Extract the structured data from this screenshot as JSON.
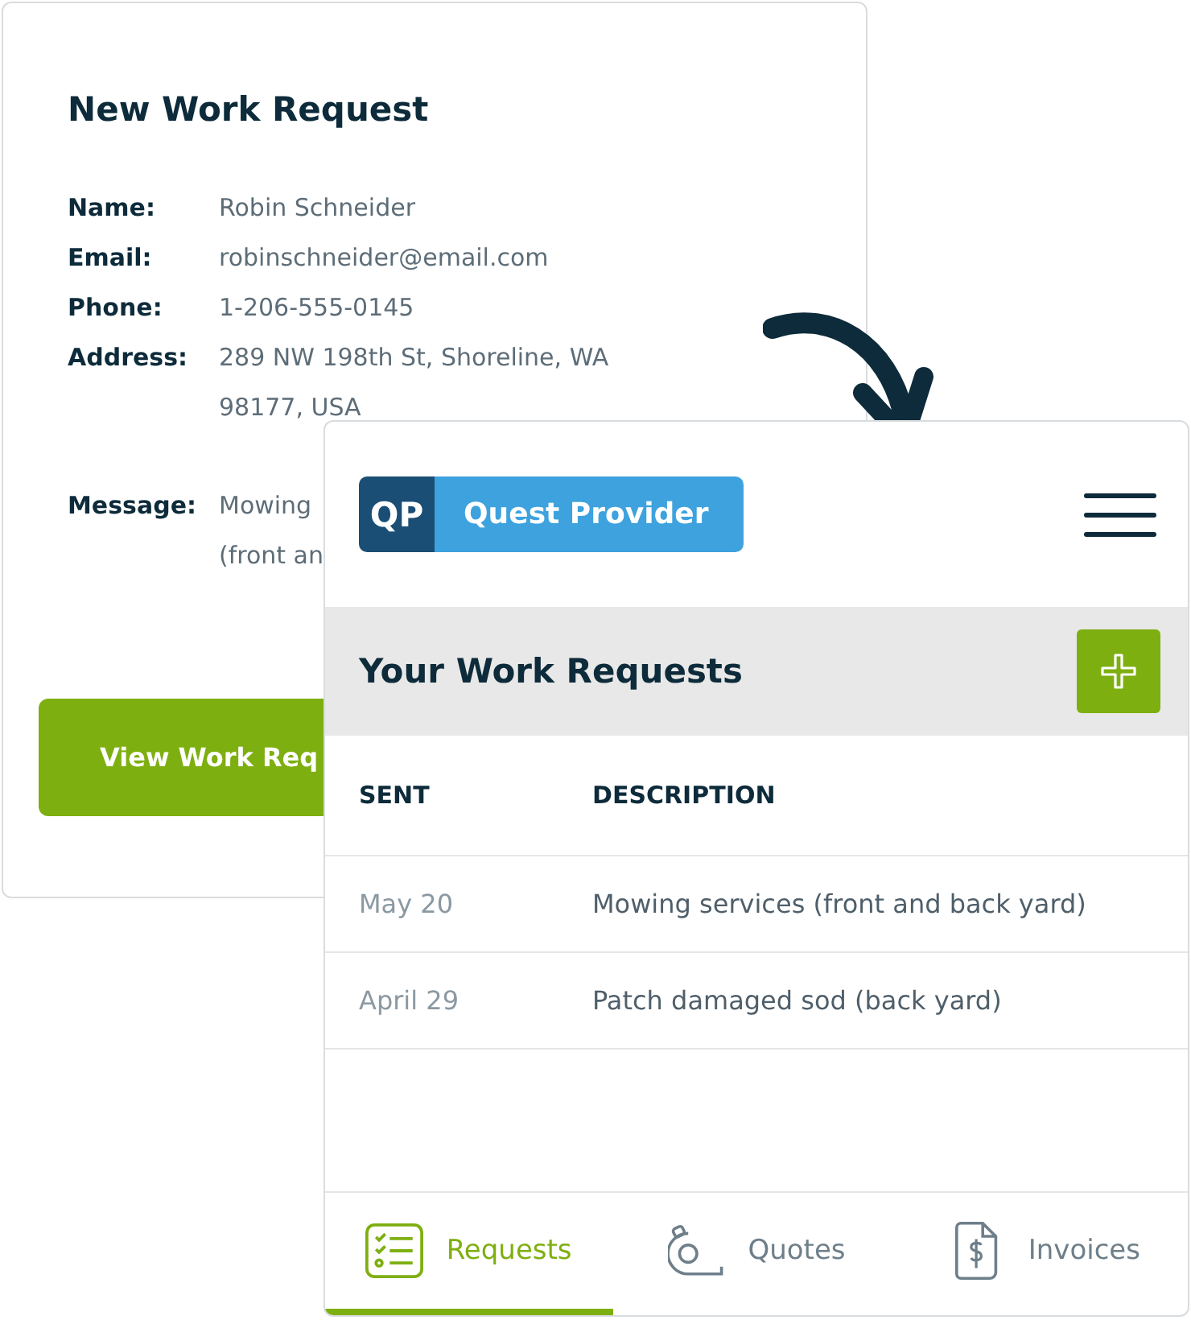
{
  "request_card": {
    "title": "New Work Request",
    "fields": [
      {
        "label": "Name:",
        "value": "Robin Schneider"
      },
      {
        "label": "Email:",
        "value": "robinschneider@email.com"
      },
      {
        "label": "Phone:",
        "value": "1-206-555-0145"
      },
      {
        "label": "Address:",
        "value": "289 NW 198th St, Shoreline, WA",
        "value_line_2": "98177, USA"
      },
      {
        "label": "Message:",
        "value": "Mowing",
        "value_line_2": "(front an"
      }
    ],
    "button": "View Work Req"
  },
  "app": {
    "logo": {
      "mark": "QP",
      "name": "Quest Provider"
    },
    "heading": "Your Work Requests",
    "table": {
      "columns": [
        "SENT",
        "DESCRIPTION"
      ],
      "rows": [
        {
          "sent": "May 20",
          "description": "Mowing services (front and back yard)"
        },
        {
          "sent": "April 29",
          "description": "Patch damaged sod (back yard)"
        }
      ]
    },
    "tabs": [
      {
        "kind": "requests",
        "label": "Requests",
        "selected": true
      },
      {
        "kind": "quotes",
        "label": "Quotes",
        "selected": false
      },
      {
        "kind": "invoices",
        "label": "Invoices",
        "selected": false
      }
    ]
  }
}
